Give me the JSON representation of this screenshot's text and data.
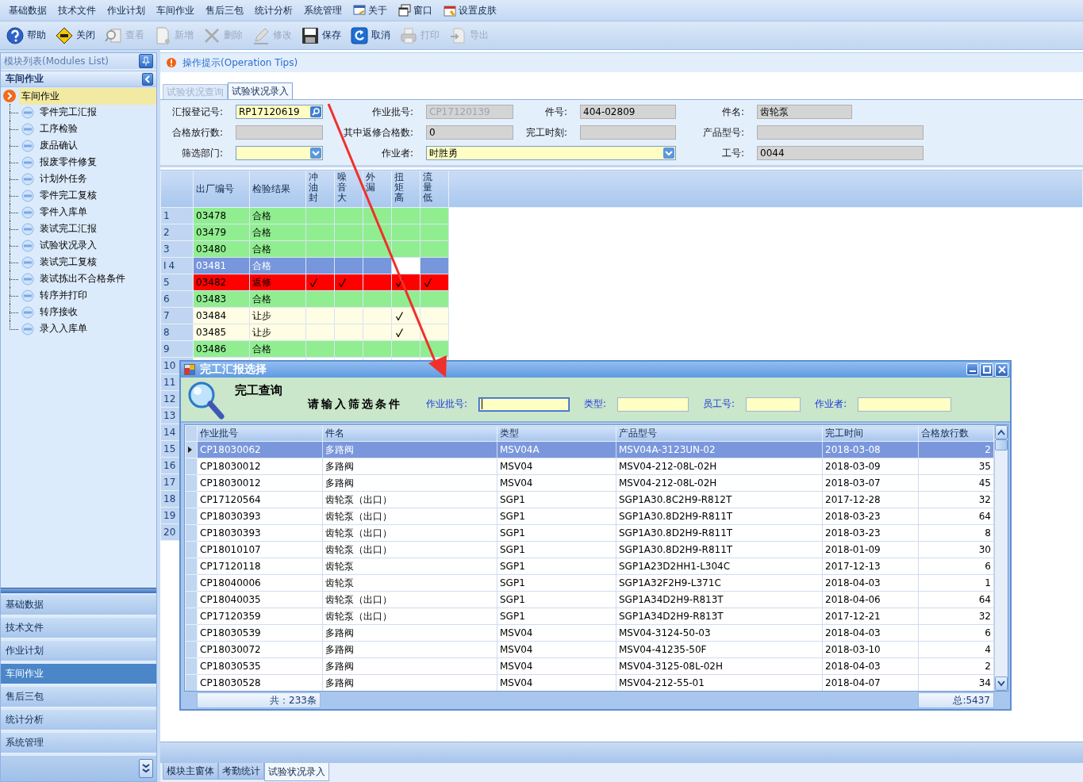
{
  "menu": [
    {
      "label": "基础数据"
    },
    {
      "label": "技术文件"
    },
    {
      "label": "作业计划"
    },
    {
      "label": "车间作业"
    },
    {
      "label": "售后三包"
    },
    {
      "label": "统计分析"
    },
    {
      "label": "系统管理"
    },
    {
      "label": "关于"
    },
    {
      "label": "窗口"
    },
    {
      "label": "设置皮肤"
    }
  ],
  "toolbar": [
    {
      "label": "帮助",
      "disabled": false
    },
    {
      "label": "关闭",
      "disabled": false
    },
    {
      "label": "查看",
      "disabled": true
    },
    {
      "label": "新增",
      "disabled": true
    },
    {
      "label": "删除",
      "disabled": true
    },
    {
      "label": "修改",
      "disabled": true
    },
    {
      "label": "保存",
      "disabled": false
    },
    {
      "label": "取消",
      "disabled": false
    },
    {
      "label": "打印",
      "disabled": true
    },
    {
      "label": "导出",
      "disabled": true
    }
  ],
  "sidebar": {
    "title": "模块列表(Modules List)",
    "group": "车间作业",
    "tree": {
      "label": "车间作业",
      "selected": true,
      "children": [
        {
          "label": "零件完工汇报",
          "selected": false
        },
        {
          "label": "工序检验",
          "selected": false
        },
        {
          "label": "废品确认",
          "selected": false
        },
        {
          "label": "报废零件修复",
          "selected": false
        },
        {
          "label": "计划外任务",
          "selected": false
        },
        {
          "label": "零件完工复核",
          "selected": false
        },
        {
          "label": "零件入库单",
          "selected": false
        },
        {
          "label": "装试完工汇报",
          "selected": false
        },
        {
          "label": "试验状况录入",
          "selected": false
        },
        {
          "label": "装试完工复核",
          "selected": false
        },
        {
          "label": "装试拣出不合格条件",
          "selected": false
        },
        {
          "label": "转序并打印",
          "selected": false
        },
        {
          "label": "转序接收",
          "selected": false
        },
        {
          "label": "录入入库单",
          "selected": false
        }
      ]
    },
    "nav": [
      {
        "label": "基础数据",
        "selected": false
      },
      {
        "label": "技术文件",
        "selected": false
      },
      {
        "label": "作业计划",
        "selected": false
      },
      {
        "label": "车间作业",
        "selected": true
      },
      {
        "label": "售后三包",
        "selected": false
      },
      {
        "label": "统计分析",
        "selected": false
      },
      {
        "label": "系统管理",
        "selected": false
      }
    ]
  },
  "tips": {
    "title": "操作提示(Operation Tips)"
  },
  "tabs": [
    {
      "label": "试验状况查询",
      "selected": false
    },
    {
      "label": "试验状况录入",
      "selected": true
    }
  ],
  "form": {
    "rows": [
      [
        {
          "label": "汇报登记号:",
          "value": "RP17120619",
          "kind": "lookup"
        },
        {
          "label": "作业批号:",
          "value": "CP17120139",
          "kind": "disabled"
        },
        {
          "label": "件号:",
          "value": "404-02809",
          "kind": "readonly"
        },
        {
          "label": "件名:",
          "value": "齿轮泵",
          "kind": "readonly"
        }
      ],
      [
        {
          "label": "合格放行数:",
          "kind": "readonly"
        },
        {
          "label": "其中返修合格数:",
          "value": "0",
          "kind": "readonly"
        },
        {
          "label": "完工时刻:",
          "kind": "readonly"
        },
        {
          "label": "产品型号:",
          "kind": "readonly"
        }
      ],
      [
        {
          "label": "筛选部门:",
          "kind": "combo"
        },
        {
          "label": "作业者:",
          "value": "时胜勇",
          "kind": "combo"
        },
        {
          "label": "工号:",
          "value": "0044",
          "kind": "readonly"
        }
      ]
    ]
  },
  "grid": {
    "columns": [
      {
        "label": "出厂编号",
        "kind": "text"
      },
      {
        "label": "检验结果",
        "kind": "text"
      },
      {
        "label": "冲油封",
        "kind": "check"
      },
      {
        "label": "噪音大",
        "kind": "check"
      },
      {
        "label": "外漏",
        "kind": "check"
      },
      {
        "label": "扭矩高",
        "kind": "check"
      },
      {
        "label": "流量低",
        "kind": "check"
      }
    ],
    "rows": [
      {
        "no": "1",
        "cells": [
          "03478",
          "合格"
        ],
        "color": "#90ee90",
        "selected": false,
        "checks": [
          {
            "checked": false,
            "focused": false
          },
          {
            "checked": false,
            "focused": false
          },
          {
            "checked": false,
            "focused": false
          },
          {
            "checked": false,
            "focused": false
          },
          {
            "checked": false,
            "focused": false
          }
        ]
      },
      {
        "no": "2",
        "cells": [
          "03479",
          "合格"
        ],
        "color": "#90ee90",
        "selected": false,
        "checks": [
          {
            "checked": false,
            "focused": false
          },
          {
            "checked": false,
            "focused": false
          },
          {
            "checked": false,
            "focused": false
          },
          {
            "checked": false,
            "focused": false
          },
          {
            "checked": false,
            "focused": false
          }
        ]
      },
      {
        "no": "3",
        "cells": [
          "03480",
          "合格"
        ],
        "color": "#90ee90",
        "selected": false,
        "checks": [
          {
            "checked": false,
            "focused": false
          },
          {
            "checked": false,
            "focused": false
          },
          {
            "checked": false,
            "focused": false
          },
          {
            "checked": false,
            "focused": false
          },
          {
            "checked": false,
            "focused": false
          }
        ]
      },
      {
        "no": "4",
        "indicator": "I",
        "cells": [
          "03481",
          "合格"
        ],
        "selected": true,
        "checks": [
          {
            "checked": false,
            "focused": false
          },
          {
            "checked": false,
            "focused": false
          },
          {
            "checked": false,
            "focused": false
          },
          {
            "checked": false,
            "focused": true
          },
          {
            "checked": false,
            "focused": false
          }
        ]
      },
      {
        "no": "5",
        "cells": [
          "03482",
          "返修"
        ],
        "color": "#ff0000",
        "selected": false,
        "checks": [
          {
            "checked": true,
            "focused": false
          },
          {
            "checked": true,
            "focused": false
          },
          {
            "checked": false,
            "focused": false
          },
          {
            "checked": true,
            "focused": false
          },
          {
            "checked": true,
            "focused": false
          }
        ]
      },
      {
        "no": "6",
        "cells": [
          "03483",
          "合格"
        ],
        "color": "#90ee90",
        "selected": false,
        "checks": [
          {
            "checked": false,
            "focused": false
          },
          {
            "checked": false,
            "focused": false
          },
          {
            "checked": false,
            "focused": false
          },
          {
            "checked": false,
            "focused": false
          },
          {
            "checked": false,
            "focused": false
          }
        ]
      },
      {
        "no": "7",
        "cells": [
          "03484",
          "让步"
        ],
        "color": "#fffde3",
        "selected": false,
        "checks": [
          {
            "checked": false,
            "focused": false
          },
          {
            "checked": false,
            "focused": false
          },
          {
            "checked": false,
            "focused": false
          },
          {
            "checked": true,
            "focused": false
          },
          {
            "checked": false,
            "focused": false
          }
        ]
      },
      {
        "no": "8",
        "cells": [
          "03485",
          "让步"
        ],
        "color": "#fffde3",
        "selected": false,
        "checks": [
          {
            "checked": false,
            "focused": false
          },
          {
            "checked": false,
            "focused": false
          },
          {
            "checked": false,
            "focused": false
          },
          {
            "checked": true,
            "focused": false
          },
          {
            "checked": false,
            "focused": false
          }
        ]
      },
      {
        "no": "9",
        "cells": [
          "03486",
          "合格"
        ],
        "color": "#90ee90",
        "selected": false,
        "checks": [
          {
            "checked": false,
            "focused": false
          },
          {
            "checked": false,
            "focused": false
          },
          {
            "checked": false,
            "focused": false
          },
          {
            "checked": false,
            "focused": false
          },
          {
            "checked": false,
            "focused": false
          }
        ]
      },
      {
        "no": "10"
      },
      {
        "no": "11"
      },
      {
        "no": "12"
      },
      {
        "no": "13"
      },
      {
        "no": "14"
      },
      {
        "no": "15"
      },
      {
        "no": "16"
      },
      {
        "no": "17"
      },
      {
        "no": "18"
      },
      {
        "no": "19"
      },
      {
        "no": "20"
      }
    ]
  },
  "bottom_tabs": [
    {
      "label": "模块主窗体",
      "selected": false
    },
    {
      "label": "考勤统计",
      "selected": false
    },
    {
      "label": "试验状况录入",
      "selected": true
    }
  ],
  "dialog": {
    "title": "完工汇报选择",
    "heading": "完工查询",
    "prompt": "请输入筛选条件",
    "filters": [
      {
        "label": "作业批号:",
        "focused": true
      },
      {
        "label": "类型:",
        "focused": false
      },
      {
        "label": "员工号:",
        "focused": false
      },
      {
        "label": "作业者:",
        "focused": false
      }
    ],
    "columns": [
      "作业批号",
      "件名",
      "类型",
      "产品型号",
      "完工时间",
      "合格放行数"
    ],
    "rows": [
      {
        "cells": [
          "CP18030062",
          "多路阀",
          "MSV04A",
          "MSV04A-3123UN-02",
          "2018-03-08",
          "2"
        ],
        "selected": true
      },
      {
        "cells": [
          "CP18030012",
          "多路阀",
          "MSV04",
          "MSV04-212-08L-02H",
          "2018-03-09",
          "35"
        ],
        "selected": false
      },
      {
        "cells": [
          "CP18030012",
          "多路阀",
          "MSV04",
          "MSV04-212-08L-02H",
          "2018-03-07",
          "45"
        ],
        "selected": false
      },
      {
        "cells": [
          "CP17120564",
          "齿轮泵（出口）",
          "SGP1",
          "SGP1A30.8C2H9-R812T",
          "2017-12-28",
          "32"
        ],
        "selected": false
      },
      {
        "cells": [
          "CP18030393",
          "齿轮泵（出口）",
          "SGP1",
          "SGP1A30.8D2H9-R811T",
          "2018-03-23",
          "64"
        ],
        "selected": false
      },
      {
        "cells": [
          "CP18030393",
          "齿轮泵（出口）",
          "SGP1",
          "SGP1A30.8D2H9-R811T",
          "2018-03-23",
          "8"
        ],
        "selected": false
      },
      {
        "cells": [
          "CP18010107",
          "齿轮泵（出口）",
          "SGP1",
          "SGP1A30.8D2H9-R811T",
          "2018-01-09",
          "30"
        ],
        "selected": false
      },
      {
        "cells": [
          "CP17120118",
          "齿轮泵",
          "SGP1",
          "SGP1A23D2HH1-L304C",
          "2017-12-13",
          "6"
        ],
        "selected": false
      },
      {
        "cells": [
          "CP18040006",
          "齿轮泵",
          "SGP1",
          "SGP1A32F2H9-L371C",
          "2018-04-03",
          "1"
        ],
        "selected": false
      },
      {
        "cells": [
          "CP18040035",
          "齿轮泵（出口）",
          "SGP1",
          "SGP1A34D2H9-R813T",
          "2018-04-06",
          "64"
        ],
        "selected": false
      },
      {
        "cells": [
          "CP17120359",
          "齿轮泵（出口）",
          "SGP1",
          "SGP1A34D2H9-R813T",
          "2017-12-21",
          "32"
        ],
        "selected": false
      },
      {
        "cells": [
          "CP18030539",
          "多路阀",
          "MSV04",
          "MSV04-3124-50-03",
          "2018-04-03",
          "6"
        ],
        "selected": false
      },
      {
        "cells": [
          "CP18030072",
          "多路阀",
          "MSV04",
          "MSV04-41235-50F",
          "2018-03-10",
          "4"
        ],
        "selected": false
      },
      {
        "cells": [
          "CP18030535",
          "多路阀",
          "MSV04",
          "MSV04-3125-08L-02H",
          "2018-04-03",
          "2"
        ],
        "selected": false
      },
      {
        "cells": [
          "CP18030528",
          "多路阀",
          "MSV04",
          "MSV04-212-55-01",
          "2018-04-07",
          "34"
        ],
        "selected": false
      }
    ],
    "total_rows": "共：233条",
    "total_qty": "总:5437"
  }
}
